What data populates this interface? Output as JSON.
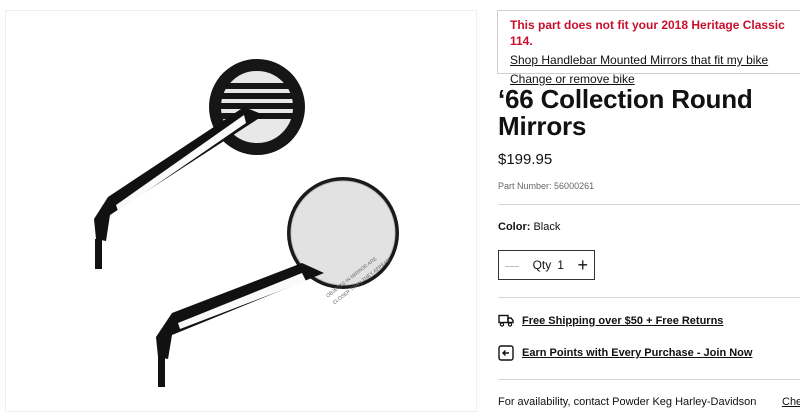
{
  "fitment": {
    "warning": "This part does not fit your 2018 Heritage Classic 114.",
    "shop_link": "Shop Handlebar Mounted Mirrors that fit my bike",
    "change_link": "Change or remove bike"
  },
  "product": {
    "title": "‘66 Collection Round Mirrors",
    "price": "$199.95",
    "part_number_label": "Part Number:",
    "part_number": "56000261",
    "color_label": "Color:",
    "color_value": "Black",
    "mirror_engraving_line1": "OBJECTS IN MIRROR ARE",
    "mirror_engraving_line2": "CLOSER THAN THEY APPEAR"
  },
  "quantity": {
    "label": "Qty",
    "value": "1",
    "minus_icon": "minus-icon",
    "plus_icon": "plus-icon"
  },
  "perks": [
    {
      "icon": "truck-icon",
      "label": "Free Shipping over $50 + Free Returns"
    },
    {
      "icon": "points-icon",
      "label": "Earn Points with Every Purchase - Join Now"
    }
  ],
  "availability": {
    "text": "For availability, contact Powder Keg Harley-Davidson",
    "check_link": "Che"
  }
}
